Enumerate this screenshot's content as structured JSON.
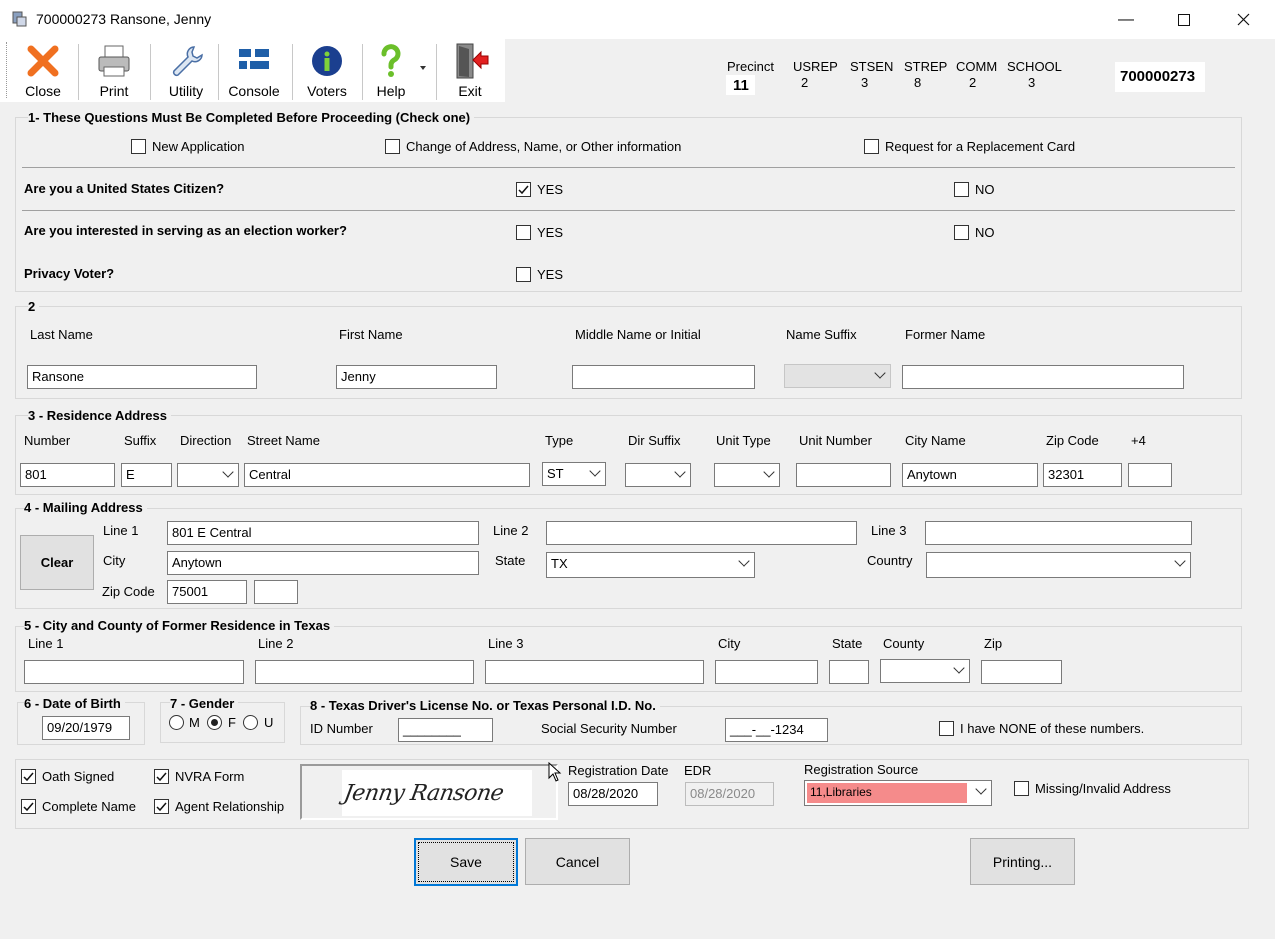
{
  "window": {
    "title": "700000273 Ransone, Jenny"
  },
  "toolbar": {
    "close": "Close",
    "print": "Print",
    "utility": "Utility",
    "console": "Console",
    "voters": "Voters",
    "help": "Help",
    "exit": "Exit"
  },
  "header": {
    "precinct_label": "Precinct",
    "precinct_value": "11",
    "usrep_label": "USREP",
    "usrep_value": "2",
    "stsen_label": "STSEN",
    "stsen_value": "3",
    "strep_label": "STREP",
    "strep_value": "8",
    "comm_label": "COMM",
    "comm_value": "2",
    "school_label": "SCHOOL",
    "school_value": "3",
    "voter_id": "700000273"
  },
  "section1": {
    "title": "1- These Questions Must Be Completed Before Proceeding (Check one)",
    "new_application": "New Application",
    "change_of_address": "Change of Address, Name, or Other information",
    "replacement_card": "Request for a Replacement Card",
    "citizen_q": "Are you a United States Citizen?",
    "election_worker_q": "Are you interested in serving as an election worker?",
    "privacy_q": "Privacy Voter?",
    "yes": "YES",
    "no": "NO",
    "citizen_yes_checked": true
  },
  "section2": {
    "title": "2",
    "last_name_label": "Last Name",
    "last_name": "Ransone",
    "first_name_label": "First Name",
    "first_name": "Jenny",
    "middle_label": "Middle Name or Initial",
    "middle": "",
    "suffix_label": "Name Suffix",
    "suffix": "",
    "former_label": "Former Name",
    "former": ""
  },
  "section3": {
    "title": "3 - Residence Address",
    "number_label": "Number",
    "number": "801",
    "suffix_label": "Suffix",
    "suffix": "E",
    "direction_label": "Direction",
    "direction": "",
    "street_label": "Street Name",
    "street": "Central",
    "type_label": "Type",
    "type": "ST",
    "dir_suffix_label": "Dir Suffix",
    "dir_suffix": "",
    "unit_type_label": "Unit Type",
    "unit_type": "",
    "unit_number_label": "Unit Number",
    "unit_number": "",
    "city_label": "City Name",
    "city": "Anytown",
    "zip_label": "Zip Code",
    "zip": "32301",
    "plus4_label": "+4",
    "plus4": ""
  },
  "section4": {
    "title": "4 - Mailing Address",
    "clear": "Clear",
    "line1_label": "Line 1",
    "line1": "801 E Central",
    "line2_label": "Line 2",
    "line2": "",
    "line3_label": "Line 3",
    "line3": "",
    "city_label": "City",
    "city": "Anytown",
    "state_label": "State",
    "state": "TX",
    "country_label": "Country",
    "country": "",
    "zip_label": "Zip Code",
    "zip": "75001",
    "zip4": ""
  },
  "section5": {
    "title": "5 - City and County of Former Residence in Texas",
    "line1_label": "Line 1",
    "line2_label": "Line 2",
    "line3_label": "Line 3",
    "city_label": "City",
    "state_label": "State",
    "county_label": "County",
    "zip_label": "Zip"
  },
  "section6": {
    "title": "6 - Date of Birth",
    "dob": "09/20/1979"
  },
  "section7": {
    "title": "7 - Gender",
    "m": "M",
    "f": "F",
    "u": "U",
    "selected": "F"
  },
  "section8": {
    "title": "8 - Texas Driver's License No. or Texas Personal I.D. No.",
    "id_label": "ID Number",
    "id_value": "________",
    "ssn_label": "Social Security Number",
    "ssn_value": "___-__-1234",
    "none_label": "I have NONE of these numbers."
  },
  "bottom": {
    "oath_signed": "Oath Signed",
    "nvra_form": "NVRA Form",
    "complete_name": "Complete Name",
    "agent_relationship": "Agent Relationship",
    "signature": "Jenny Ransone",
    "reg_date_label": "Registration Date",
    "reg_date": "08/28/2020",
    "edr_label": "EDR",
    "edr": "08/28/2020",
    "reg_source_label": "Registration Source",
    "reg_source": "11,Libraries",
    "missing_address": "Missing/Invalid Address"
  },
  "buttons": {
    "save": "Save",
    "cancel": "Cancel",
    "printing": "Printing..."
  },
  "colors": {
    "reg_source_bg": "#f58b8b",
    "accent": "#0078d7"
  }
}
